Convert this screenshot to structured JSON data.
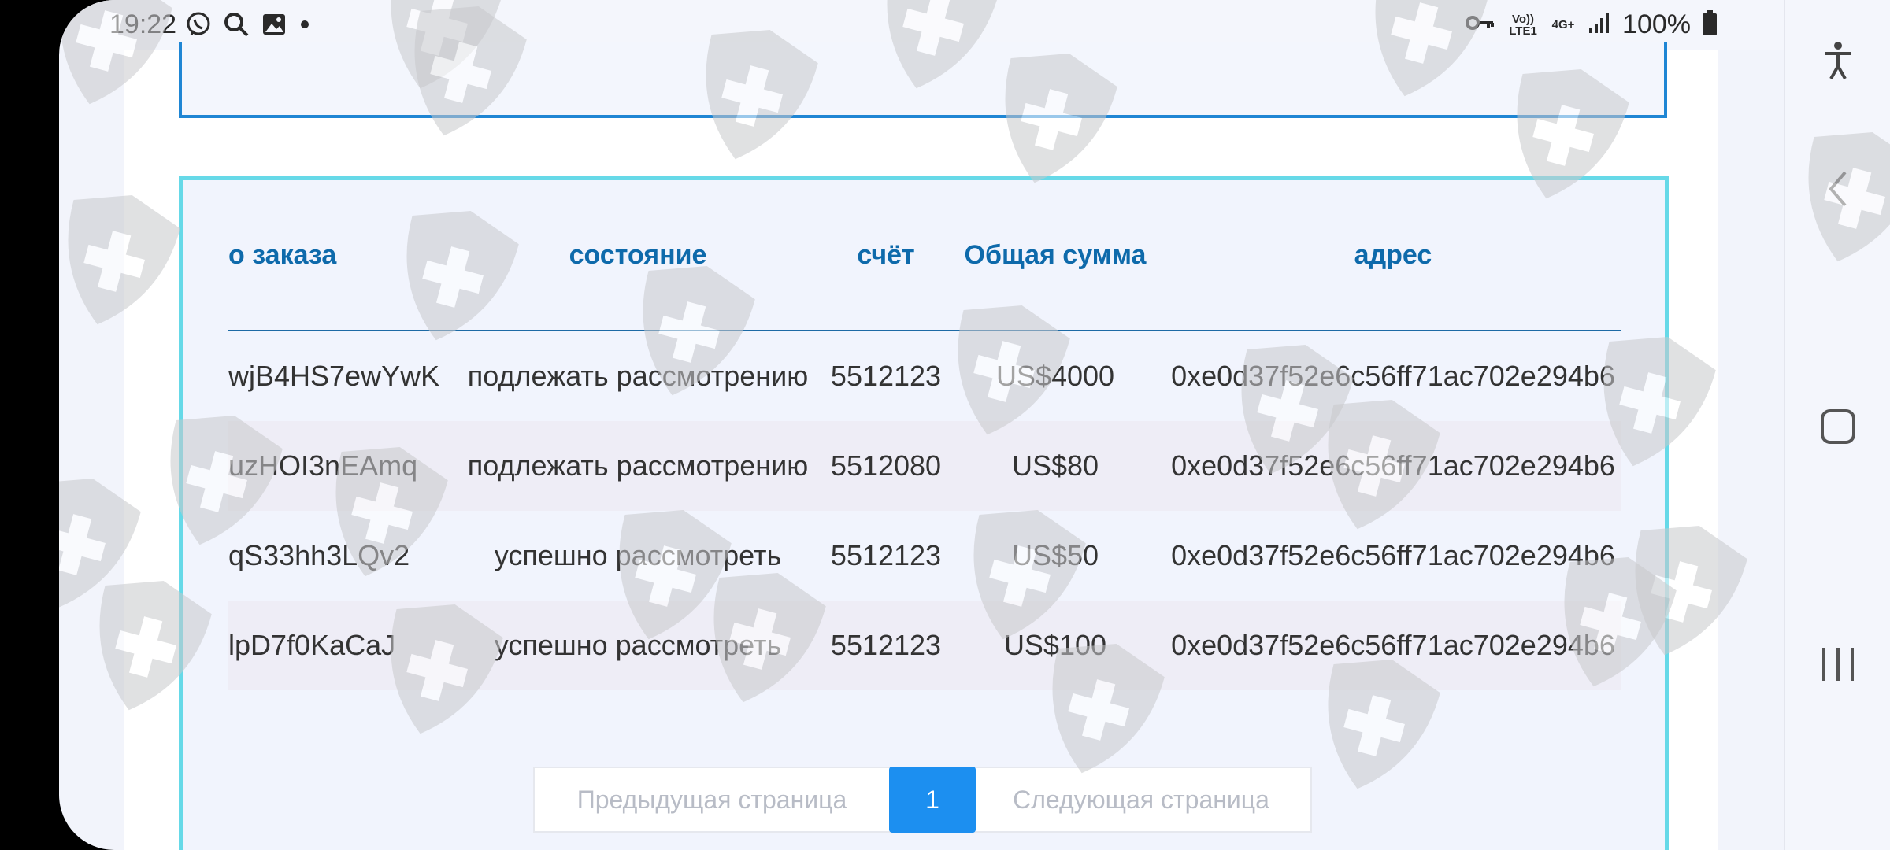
{
  "status_bar": {
    "time": "19:22",
    "battery_percent": "100%",
    "network_top": "Vo)) LTE1",
    "network_type": "4G+",
    "icons": [
      "viber-icon",
      "search-icon",
      "gallery-icon",
      "dot-icon",
      "key-icon",
      "signal-icon",
      "battery-icon"
    ]
  },
  "orders_table": {
    "headers": {
      "order_no": "о заказа",
      "status": "состояние",
      "account": "счёт",
      "total": "Общая сумма",
      "address": "адрес"
    },
    "rows": [
      {
        "order_no": "wjB4HS7ewYwK",
        "status": "подлежать рассмотрению",
        "account": "5512123",
        "total": "US$4000",
        "address": "0xe0d37f52e6c56ff71ac702e294b6"
      },
      {
        "order_no": "uzHOI3nEAmq",
        "status": "подлежать рассмотрению",
        "account": "5512080",
        "total": "US$80",
        "address": "0xe0d37f52e6c56ff71ac702e294b6"
      },
      {
        "order_no": "qS33hh3LQv2",
        "status": "успешно рассмотреть",
        "account": "5512123",
        "total": "US$50",
        "address": "0xe0d37f52e6c56ff71ac702e294b6"
      },
      {
        "order_no": "lpD7f0KaCaJ",
        "status": "успешно рассмотреть",
        "account": "5512123",
        "total": "US$100",
        "address": "0xe0d37f52e6c56ff71ac702e294b6"
      }
    ]
  },
  "pagination": {
    "prev_label": "Предыдущая страница",
    "current_page": "1",
    "next_label": "Следующая страница"
  },
  "nav_bar": {
    "buttons": [
      "accessibility-icon",
      "back-icon",
      "home-icon",
      "recents-icon"
    ]
  },
  "colors": {
    "header_text": "#0e6aab",
    "card_border_top": "#1f86d4",
    "card_border_orders": "#66d9e8",
    "page_active": "#1c8ff0"
  }
}
